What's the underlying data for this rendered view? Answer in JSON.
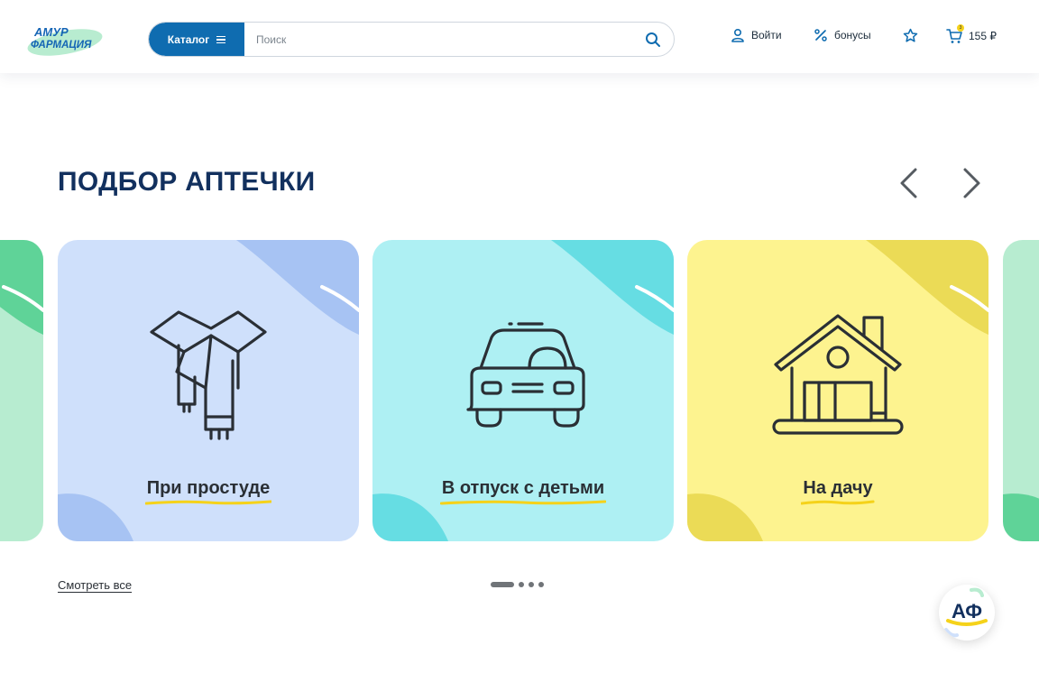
{
  "header": {
    "logo": {
      "line1": "АМУР",
      "line2": "ФАРМАЦИЯ"
    },
    "catalog_label": "Каталог",
    "search_placeholder": "Поиск",
    "login_label": "Войти",
    "bonus_label": "бонусы",
    "cart_count": "3",
    "cart_total": "155 ₽"
  },
  "section": {
    "title": "ПОДБОР АПТЕЧКИ",
    "see_all": "Смотреть все",
    "cards": [
      {
        "label": "При простуде",
        "icon": "scarf-icon",
        "bg": "#cfe0fb",
        "accent": "#a7c3f3"
      },
      {
        "label": "В отпуск с детьми",
        "icon": "car-icon",
        "bg": "#aef0f3",
        "accent": "#66dde3"
      },
      {
        "label": "На дачу",
        "icon": "house-icon",
        "bg": "#fdf38f",
        "accent": "#ebdb56"
      }
    ],
    "pagination": {
      "total": 4,
      "active": 1
    }
  },
  "chat": {
    "label": "АФ"
  },
  "colors": {
    "primary": "#0f6cb0",
    "title": "#12305e",
    "highlight": "#f5d21a"
  }
}
